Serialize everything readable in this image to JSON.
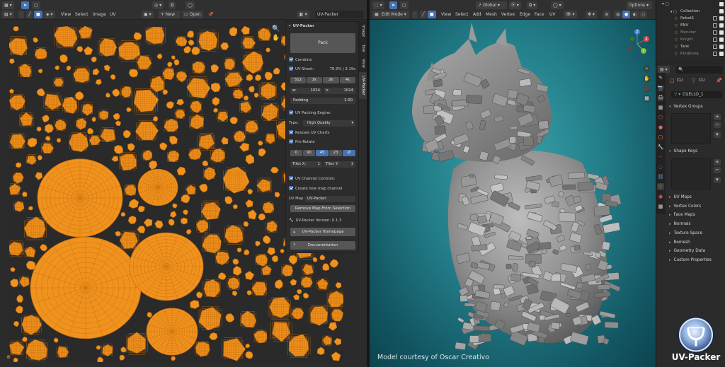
{
  "uv_editor": {
    "header": {
      "view": "View",
      "select": "Select",
      "image": "Image",
      "uv": "UV",
      "new_button": "New",
      "open_button": "Open",
      "datablock": "UV-Packer"
    },
    "side_tabs": [
      "Image",
      "Tool",
      "View",
      "UV-Packer"
    ]
  },
  "uv_packer_panel": {
    "title": "UV-Packer",
    "pack_button": "Pack",
    "combine": "Combine",
    "uv_sheet_label": "UV Sheet:",
    "uv_sheet_value": "78.3% | 3.19s",
    "resolutions": [
      "512",
      "1k",
      "2k",
      "4k"
    ],
    "width_label": "w:",
    "width_value": "1024",
    "height_label": "h:",
    "height_value": "1024",
    "padding_label": "Padding",
    "padding_value": "2.00",
    "engine_label": "UV Packing Engine:",
    "type_label": "Type:",
    "type_value": "High Quality",
    "rescale": "Rescale UV Charts",
    "prerotate": "Pre-Rotate",
    "angles": [
      "0",
      "90",
      "45",
      "23",
      "Ø"
    ],
    "tiles_x_label": "Tiles X:",
    "tiles_x_value": "1",
    "tiles_y_label": "Tiles Y:",
    "tiles_y_value": "1",
    "channel_label": "UV Channel Controls:",
    "create_map": "Create new map channel",
    "uv_map_label": "UV Map:",
    "uv_map_value": "UV-Packer",
    "remove_map_button": "Remove Map From Selection",
    "version": "UV-Packer Version: 0.1.3",
    "homepage_button": "UV-Packer Homepage",
    "docs_button": "Documentation"
  },
  "viewport": {
    "header": {
      "mode": "Edit Mode",
      "view": "View",
      "select": "Select",
      "add": "Add",
      "mesh": "Mesh",
      "vertex": "Vertex",
      "edge": "Edge",
      "face": "Face",
      "uv": "UV",
      "orientation": "Global",
      "options": "Options"
    },
    "gizmo": {
      "x": "X",
      "y": "Y",
      "z": "Z"
    },
    "credit": "Model courtesy of Oscar Creativo"
  },
  "outliner": {
    "items": [
      {
        "name": "Collection"
      },
      {
        "name": "Robot1"
      },
      {
        "name": "ENV"
      },
      {
        "name": "Monster"
      },
      {
        "name": "Knight"
      },
      {
        "name": "Tank"
      },
      {
        "name": "KingKong"
      }
    ]
  },
  "properties": {
    "object_short": "CU",
    "mesh_short": "CU",
    "mesh_name": "CUELLO_1",
    "sections": [
      {
        "label": "Vertex Groups"
      },
      {
        "label": "Shape Keys"
      },
      {
        "label": "UV Maps"
      },
      {
        "label": "Vertex Colors"
      },
      {
        "label": "Face Maps"
      },
      {
        "label": "Normals"
      },
      {
        "label": "Texture Space"
      },
      {
        "label": "Remesh"
      },
      {
        "label": "Geometry Data"
      },
      {
        "label": "Custom Properties"
      }
    ]
  },
  "logo": {
    "text": "UV-Packer"
  },
  "colors": {
    "uv_island": "#f0921e",
    "uv_wire": "#c86f0d",
    "accent_blue": "#4772b3",
    "viewport_teal": "#227d88"
  }
}
